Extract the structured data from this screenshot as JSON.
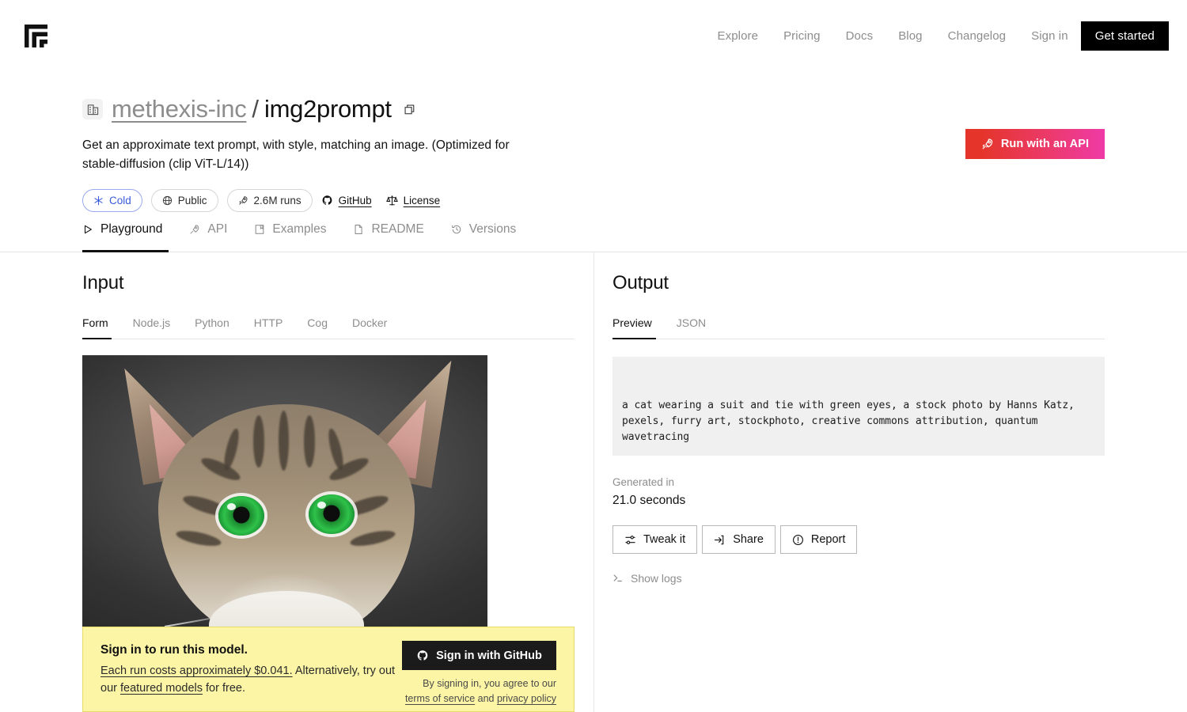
{
  "topnav": {
    "logo_name": "replicate-logo",
    "links": [
      {
        "label": "Explore"
      },
      {
        "label": "Pricing"
      },
      {
        "label": "Docs"
      },
      {
        "label": "Blog"
      },
      {
        "label": "Changelog"
      },
      {
        "label": "Sign in"
      }
    ],
    "cta_label": "Get started"
  },
  "model": {
    "org": "methexis-inc",
    "separator": "/",
    "name": "img2prompt",
    "description": "Get an approximate text prompt, with style, matching an image. (Optimized for stable-diffusion (clip ViT-L/14))",
    "badges": [
      {
        "label": "Cold",
        "icon": "snowflake-icon",
        "accent": "#3b5bdb"
      },
      {
        "label": "Public",
        "icon": "globe-icon"
      },
      {
        "label": "2.6M runs",
        "icon": "rocket-icon"
      }
    ],
    "links": [
      {
        "label": "GitHub",
        "icon": "github-icon"
      },
      {
        "label": "License",
        "icon": "scales-icon"
      }
    ],
    "run_api_label": "Run with an API",
    "run_api_icon": "rocket-icon",
    "run_api_gradient_from": "#e5352b",
    "run_api_gradient_to": "#ef3aa7"
  },
  "tabs": [
    {
      "label": "Playground",
      "icon": "play-icon",
      "active": true
    },
    {
      "label": "API",
      "icon": "rocket-icon",
      "active": false
    },
    {
      "label": "Examples",
      "icon": "book-icon",
      "active": false
    },
    {
      "label": "README",
      "icon": "document-icon",
      "active": false
    },
    {
      "label": "Versions",
      "icon": "history-icon",
      "active": false
    }
  ],
  "input": {
    "title": "Input",
    "subtabs": [
      {
        "label": "Form",
        "active": true
      },
      {
        "label": "Node.js",
        "active": false
      },
      {
        "label": "Python",
        "active": false
      },
      {
        "label": "HTTP",
        "active": false
      },
      {
        "label": "Cog",
        "active": false
      },
      {
        "label": "Docker",
        "active": false
      }
    ],
    "image_alt": "close-up photo of a tabby cat with bright green eyes"
  },
  "signin": {
    "title": "Sign in to run this model.",
    "body_link_1": "Each run costs approximately $0.041.",
    "body_mid": " Alternatively, try out our ",
    "body_link_2": "featured models",
    "body_end": " for free.",
    "github_button": "Sign in with GitHub",
    "github_icon": "github-icon",
    "legal_prefix": "By signing in, you agree to our ",
    "legal_link_1": "terms of service",
    "legal_and": " and ",
    "legal_link_2": "privacy policy"
  },
  "output": {
    "title": "Output",
    "subtabs": [
      {
        "label": "Preview",
        "active": true
      },
      {
        "label": "JSON",
        "active": false
      }
    ],
    "result_text": "a cat wearing a suit and tie with green eyes, a stock photo by Hanns Katz, pexels, furry art, stockphoto, creative commons attribution, quantum wavetracing",
    "generated_label": "Generated in",
    "generated_value": "21.0 seconds",
    "buttons": [
      {
        "label": "Tweak it",
        "icon": "sliders-icon"
      },
      {
        "label": "Share",
        "icon": "share-arrow-icon"
      },
      {
        "label": "Report",
        "icon": "alert-circle-icon"
      }
    ],
    "show_logs_label": "Show logs",
    "show_logs_icon": "terminal-icon"
  }
}
